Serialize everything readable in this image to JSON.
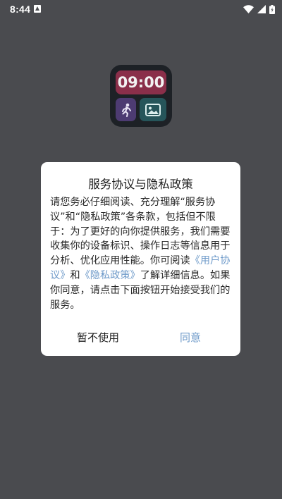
{
  "status_bar": {
    "time": "8:44",
    "icons": [
      "app-notification-icon",
      "wifi-icon",
      "signal-icon",
      "battery-icon"
    ]
  },
  "app": {
    "logo_clock_text": "09:00",
    "logo_icons": [
      "running-person-icon",
      "image-icon"
    ]
  },
  "dialog": {
    "title": "服务协议与隐私政策",
    "body_intro": "请您务必仔细阅读、充分理解“服务协议”和“隐私政策”各条款，包括但不限于：为了更好的向你提供服务，我们需要收集你的设备标识、操作日志等信息用于分析、优化应用性能。你可阅读",
    "user_agreement_link": "《用户协议》",
    "and_text": "和",
    "privacy_policy_link": "《隐私政策》",
    "body_outro": "了解详细信息。如果你同意，请点击下面按钮开始接受我们的服务。",
    "decline_label": "暂不使用",
    "agree_label": "同意"
  },
  "colors": {
    "overlay_background": "#4a4b4f",
    "dialog_background": "#ffffff",
    "link": "#6e9ac9",
    "logo_clock": "#8a2f4a",
    "logo_tile_left": "#4d3b72",
    "logo_tile_right": "#26555a"
  }
}
